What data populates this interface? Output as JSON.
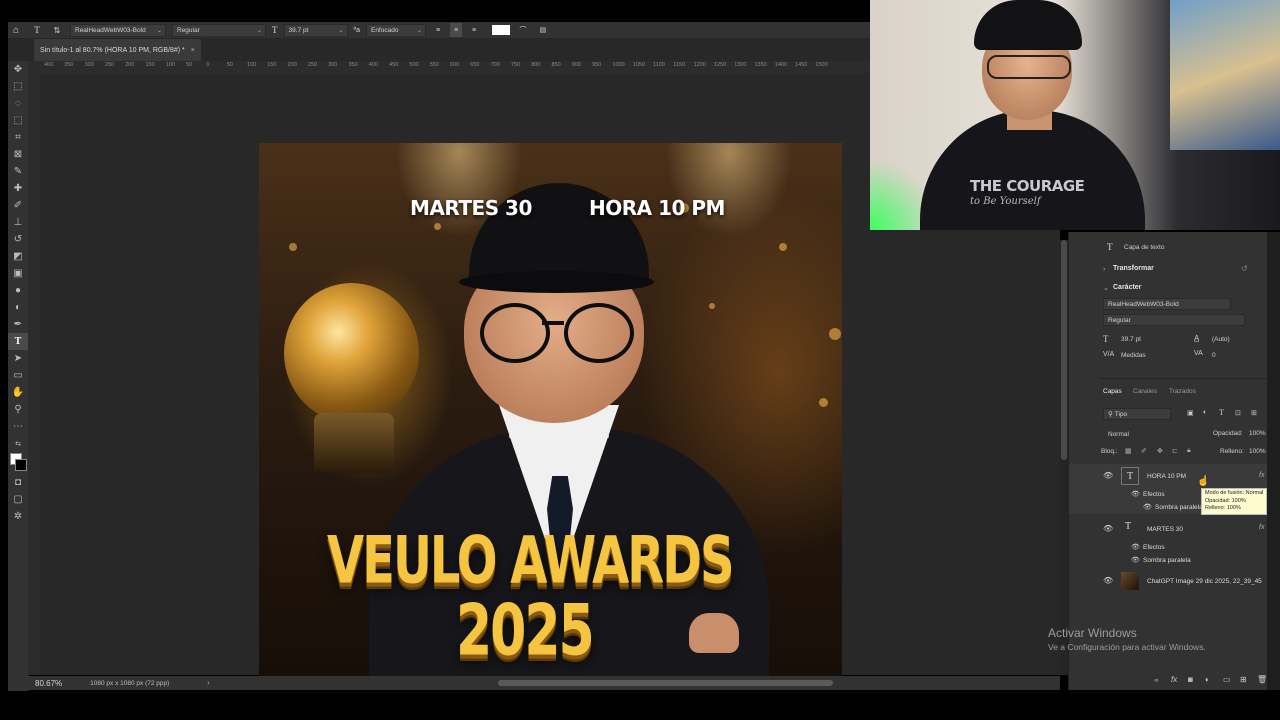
{
  "options_bar": {
    "font_family": "RealHeadWebW03-Bold",
    "font_style": "Regular",
    "font_size": "39.7 pt",
    "antialias": "Enfocado"
  },
  "document_tab": {
    "title": "Sin título-1 al 80.7% (HORA 10 PM, RGB/8#) *",
    "close": "×"
  },
  "ruler": {
    "marks": [
      "400",
      "350",
      "300",
      "250",
      "200",
      "150",
      "100",
      "50",
      "0",
      "50",
      "100",
      "150",
      "200",
      "250",
      "300",
      "350",
      "400",
      "450",
      "500",
      "550",
      "600",
      "650",
      "700",
      "750",
      "800",
      "850",
      "900",
      "950",
      "1000",
      "1050",
      "1100",
      "1150",
      "1200",
      "1250",
      "1300",
      "1350",
      "1400",
      "1450",
      "1500"
    ]
  },
  "canvas": {
    "text_left": "MARTES 30",
    "text_right": "HORA 10 PM",
    "title_line1": "VEULO AWARDS",
    "title_line2": "2025"
  },
  "status": {
    "zoom": "80.67%",
    "doc_info": "1080 px x 1080 px (72 ppp)",
    "arrow": "›"
  },
  "properties": {
    "layer_kind": "Capa de texto",
    "transform_title": "Transformar",
    "character_title": "Carácter",
    "font_family": "RealHeadWebW03-Bold",
    "font_style": "Regular",
    "font_size": "39.7 pt",
    "leading": "(Auto)",
    "kerning": "Medidas",
    "tracking": "0"
  },
  "layers_panel": {
    "tabs": [
      "Capas",
      "Canales",
      "Trazados"
    ],
    "filter": "Tipo",
    "blend_mode": "Normal",
    "opacity_label": "Opacidad:",
    "opacity_value": "100%",
    "lock_label": "Bloq.:",
    "fill_label": "Relleno:",
    "fill_value": "100%",
    "layers": [
      {
        "name": "HORA 10 PM",
        "effects": "Efectos",
        "effect": "Sombra paralela"
      },
      {
        "name": "MARTES 30",
        "effects": "Efectos",
        "effect": "Sombra paralela"
      },
      {
        "name": "ChatGPT Image 29 dic 2025, 22_39_45"
      }
    ],
    "tooltip": {
      "line1": "Modo de fusión: Normal",
      "line2": "Opacidad: 100%",
      "line3": "Relleno: 100%"
    }
  },
  "watermark": {
    "title": "Activar Windows",
    "subtitle": "Ve a Configuración para activar Windows."
  },
  "webcam": {
    "shirt_text_1": "THE COURAGE",
    "shirt_text_2": "to Be Yourself"
  }
}
